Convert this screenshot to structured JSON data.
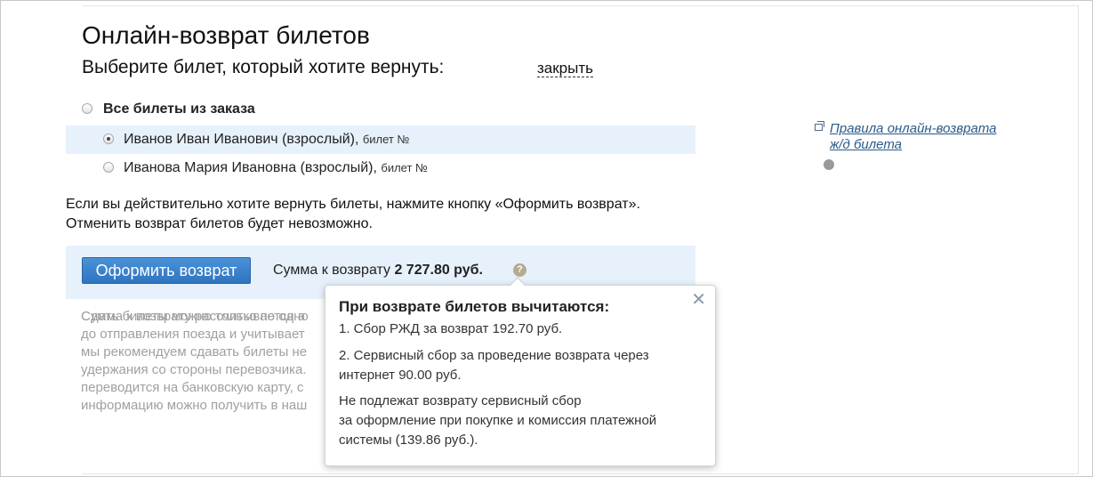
{
  "header": {
    "title": "Онлайн-возврат билетов",
    "subtitle": "Выберите билет, который хотите вернуть:",
    "close_label": "закрыть"
  },
  "selection": {
    "all_label": "Все билеты из заказа",
    "passengers": [
      {
        "name": "Иванов Иван Иванович (взрослый)",
        "ticket_label": "билет №",
        "selected": true
      },
      {
        "name": "Иванова Мария Ивановна (взрослый)",
        "ticket_label": "билет №",
        "selected": false
      }
    ]
  },
  "confirm": {
    "text": "Если вы действительно хотите вернуть билеты, нажмите кнопку «Оформить возврат». Отменить возврат билетов будет невозможно."
  },
  "action": {
    "button_label": "Оформить возврат",
    "sum_label": "Сумма к возврату",
    "sum_value": "2 727.80 руб.",
    "help_icon": "?"
  },
  "info": {
    "lines": [
      "Сумма к возврату рассчитывается а",
      "до отправления поезда и учитывает",
      "мы рекомендуем сдавать билеты не",
      "удержания со стороны перевозчика.",
      "переводится на банковскую карту, с",
      "информацию можно получить в наш"
    ],
    "last_line": "Сдать билеты можно только по одно"
  },
  "tooltip": {
    "title": "При возврате билетов вычитаются:",
    "close_glyph": "✕",
    "lines": [
      "1. Сбор РЖД за возврат 192.70 руб.",
      "2. Сервисный сбор за проведение возврата через",
      "интернет 90.00 руб.",
      "Не подлежат возврату сервисный сбор",
      "за оформление при покупке и комиссия платежной",
      "системы (139.86 руб.)."
    ]
  },
  "sidebar": {
    "rules_link": "Правила онлайн-возврата ж/д билета"
  }
}
